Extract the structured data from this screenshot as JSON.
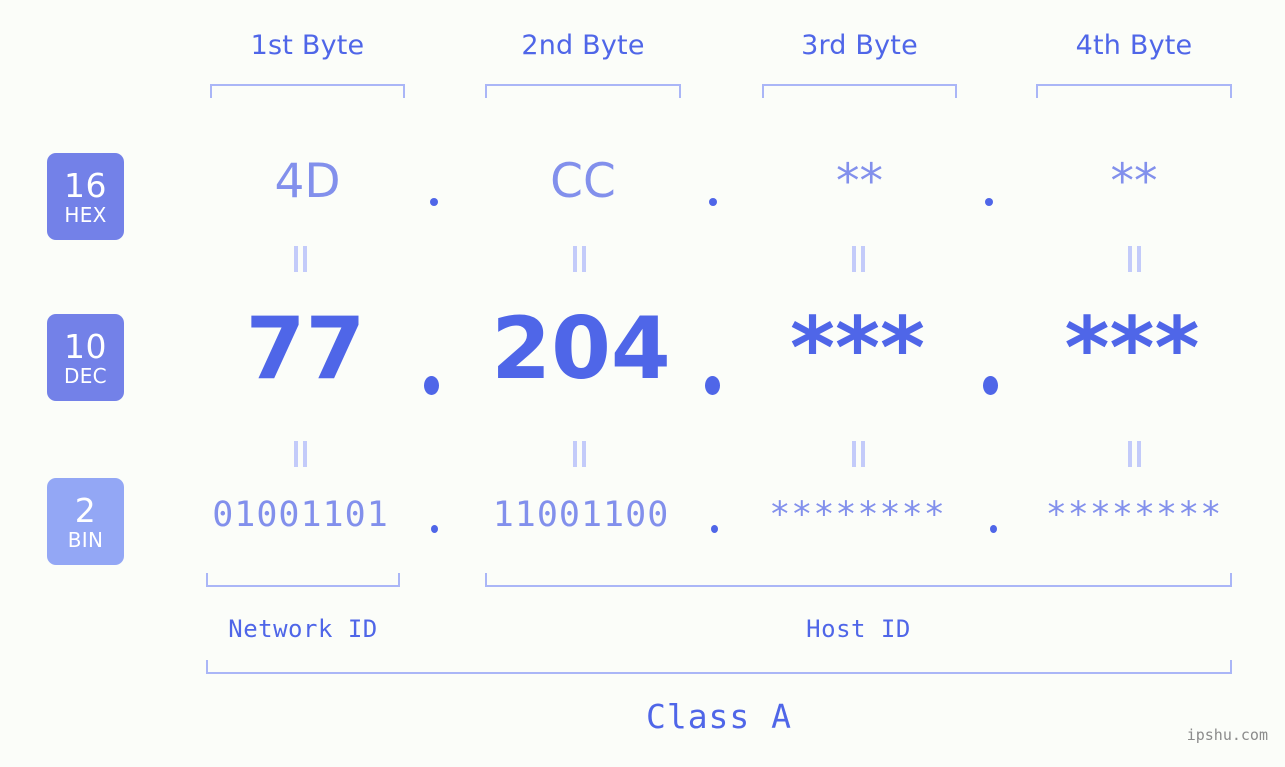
{
  "background_color": "#fbfdf9",
  "accent_color": "#4f66e8",
  "accent_light_color": "#8290ec",
  "bracket_color": "#aab6f7",
  "byte_headers": [
    {
      "label": "1st Byte"
    },
    {
      "label": "2nd Byte"
    },
    {
      "label": "3rd Byte"
    },
    {
      "label": "4th Byte"
    }
  ],
  "rows": {
    "hex": {
      "badge_number": "16",
      "badge_name": "HEX",
      "badge_color": "#7381e8",
      "values": [
        "4D",
        "CC",
        "**",
        "**"
      ],
      "separator": "."
    },
    "dec": {
      "badge_number": "10",
      "badge_name": "DEC",
      "badge_color": "#7381e8",
      "values": [
        "77",
        "204",
        "***",
        "***"
      ],
      "separator": "."
    },
    "bin": {
      "badge_number": "2",
      "badge_name": "BIN",
      "badge_color": "#93a7f5",
      "values": [
        "01001101",
        "11001100",
        "********",
        "********"
      ],
      "separator": "."
    }
  },
  "equality_marks": [
    "=",
    "=",
    "=",
    "=",
    "=",
    "=",
    "=",
    "="
  ],
  "segments": {
    "network_id": "Network ID",
    "host_id": "Host ID",
    "class": "Class A"
  },
  "watermark": "ipshu.com"
}
